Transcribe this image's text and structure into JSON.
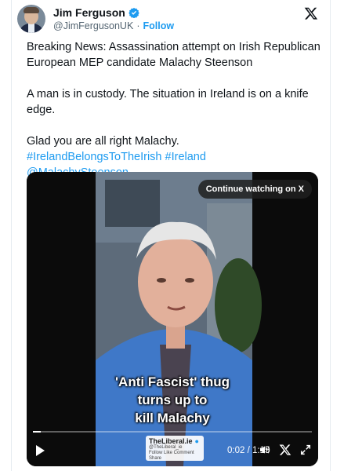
{
  "author": {
    "display_name": "Jim Ferguson",
    "handle": "@JimFergusonUK",
    "follow_label": "Follow"
  },
  "tweet": {
    "paragraph1": "Breaking News: Assassination attempt on Irish Republican European MEP candidate Malachy Steenson",
    "paragraph2": "A man is in custody. The situation in Ireland is on a knife edge.",
    "paragraph3_line1": "Glad you are all right Malachy.",
    "hashtag1": "#IrelandBelongsToTheIrish",
    "hashtag2": "#Ireland",
    "mention": "@MalachySteenson"
  },
  "video": {
    "continue_label": "Continue watching on X",
    "caption_line1": "'Anti Fascist' thug",
    "caption_line2": "turns up to",
    "caption_line3": "kill Malachy",
    "time": "0:02 / 1:15",
    "progress_fraction": 0.027,
    "watermark_title": "TheLiberal.ie",
    "watermark_handle": "@TheLiberal_ie",
    "watermark_line": "Follow Like Comment Share"
  },
  "icons": {
    "verified": "verified-badge-icon",
    "x_logo": "x-logo-icon",
    "play": "play-icon",
    "volume": "volume-icon",
    "x_small": "x-logo-small-icon",
    "fullscreen": "fullscreen-icon"
  },
  "colors": {
    "accent": "#1d9bf0",
    "text": "#0f1419",
    "secondary": "#536471"
  }
}
